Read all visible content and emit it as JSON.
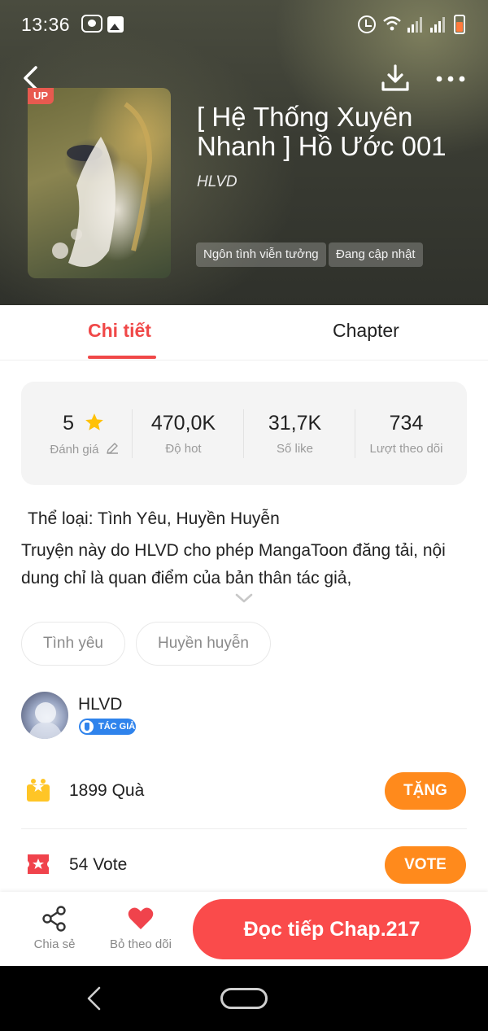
{
  "status_bar": {
    "time": "13:36"
  },
  "header": {
    "up_badge": "UP",
    "title": "[ Hệ Thống Xuyên Nhanh ] Hồ Ước 001",
    "author": "HLVD",
    "tags": [
      "Ngôn tình viễn tưởng",
      "Đang cập nhật"
    ],
    "icons": {
      "back": "back-arrow-icon",
      "download": "download-icon",
      "more": "more-dots-icon"
    }
  },
  "tabs": [
    {
      "label": "Chi tiết",
      "active": true
    },
    {
      "label": "Chapter",
      "active": false
    }
  ],
  "stats": [
    {
      "value": "5",
      "label": "Đánh giá"
    },
    {
      "value": "470,0K",
      "label": "Độ hot"
    },
    {
      "value": "31,7K",
      "label": "Số like"
    },
    {
      "value": "734",
      "label": "Lượt theo dõi"
    }
  ],
  "description": {
    "genre_line": "Thể loại: Tình Yêu, Huyền Huyễn",
    "text": "Truyện này do HLVD cho phép MangaToon đăng tải, nội dung chỉ là quan điểm của bản thân tác giả,"
  },
  "genre_chips": [
    "Tình yêu",
    "Huyền huyễn"
  ],
  "author": {
    "name": "HLVD",
    "badge": "TÁC GIẢ"
  },
  "gifts": {
    "count": "1899",
    "unit": "Quà",
    "button": "TẶNG"
  },
  "votes": {
    "count": "54",
    "unit": "Vote",
    "button": "VOTE"
  },
  "bottom_bar": {
    "share_label": "Chia sẻ",
    "unfollow_label": "Bỏ theo dõi",
    "read_button": "Đọc tiếp Chap.217"
  },
  "colors": {
    "accent_red": "#f04848",
    "read_button": "#fa4b4b",
    "orange_button": "#ff8a1c",
    "author_badge": "#2f83ec",
    "star": "#ffc107"
  }
}
